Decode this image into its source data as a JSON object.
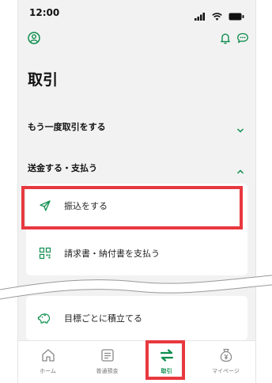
{
  "status_bar": {
    "time": "12:00"
  },
  "header": {
    "title": "取引"
  },
  "sections": [
    {
      "label": "もう一度取引をする",
      "state": "collapsed"
    },
    {
      "label": "送金する・支払う",
      "state": "expanded"
    }
  ],
  "menu_items": [
    {
      "label": "振込をする",
      "icon": "send-icon",
      "highlighted": true
    },
    {
      "label": "請求書・納付書を支払う",
      "icon": "qr-code-icon"
    }
  ],
  "goal_item": {
    "label": "目標ごとに積立てる",
    "icon": "piggy-bank-icon"
  },
  "tab_bar": [
    {
      "label": "ホーム",
      "icon": "home-icon"
    },
    {
      "label": "普通預金",
      "icon": "passbook-icon"
    },
    {
      "label": "取引",
      "icon": "transfer-arrows-icon",
      "active": true
    },
    {
      "label": "マイページ",
      "icon": "money-bag-icon"
    }
  ],
  "colors": {
    "accent": "#0f8d4e",
    "highlight": "#e8383f",
    "background": "#f2f2f2"
  }
}
